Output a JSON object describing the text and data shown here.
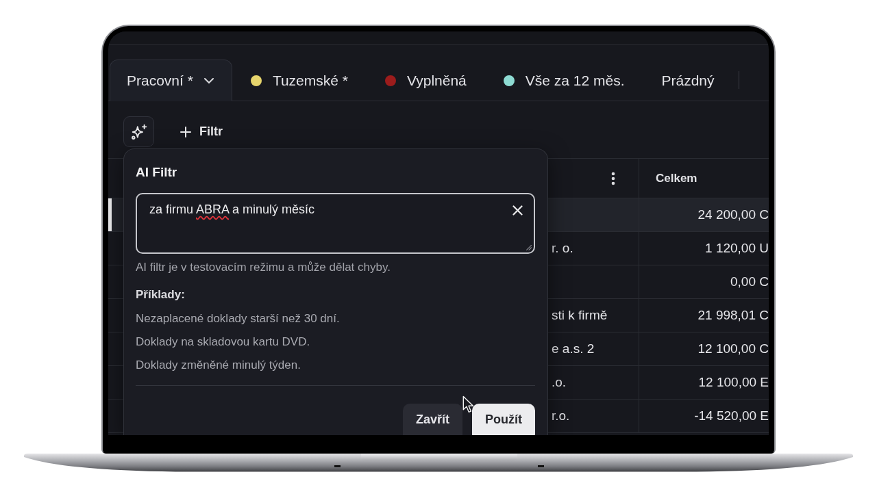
{
  "tabs": [
    {
      "label": "Pracovní *",
      "selected": true,
      "dropdown": true
    },
    {
      "label": "Tuzemské *",
      "selected": false,
      "dropdown": false,
      "color": "#e6d46c"
    },
    {
      "label": "Vyplněná",
      "selected": false,
      "dropdown": false,
      "color": "#9c1c1c"
    },
    {
      "label": "Vše za 12 měs.",
      "selected": false,
      "dropdown": false,
      "color": "#8edbd3"
    },
    {
      "label": "Prázdný",
      "selected": false,
      "dropdown": false
    }
  ],
  "toolbar": {
    "filter_button": "Filtr"
  },
  "table": {
    "columns": [
      {
        "menu": true
      },
      {
        "label": "Celkem",
        "menu": false
      }
    ],
    "rows": [
      {
        "selected": true,
        "celkem": "24 200,00 C"
      },
      {
        "selected": false,
        "column_1": "r. o.",
        "celkem": "1 120,00 U"
      },
      {
        "selected": false,
        "celkem": "0,00 C"
      },
      {
        "selected": false,
        "column_1": "sti k firmě",
        "celkem": "21 998,01 C"
      },
      {
        "selected": false,
        "column_1": "e a.s. 2",
        "celkem": "12 100,00 C"
      },
      {
        "selected": false,
        "column_1": ".o.",
        "celkem": "12 100,00 E"
      },
      {
        "selected": false,
        "column_1": "r.o.",
        "celkem": "-14 520,00 E"
      }
    ]
  },
  "ai_filter": {
    "title": "AI Filtr",
    "query": [
      {
        "text": "za firmu ",
        "misspelled": false
      },
      {
        "text": "ABRA",
        "misspelled": true
      },
      {
        "text": " a minulý měsíc",
        "misspelled": false
      }
    ],
    "note": "AI filtr je v testovacím režimu a může dělat chyby.",
    "examples_heading": "Příklady:",
    "examples": [
      "Nezaplacené doklady starší než 30 dní.",
      "Doklady na skladovou kartu DVD.",
      "Doklady změněné minulý týden."
    ],
    "buttons": [
      {
        "label": "Zavřít",
        "kind": "secondary"
      },
      {
        "label": "Použít",
        "kind": "primary"
      }
    ]
  }
}
